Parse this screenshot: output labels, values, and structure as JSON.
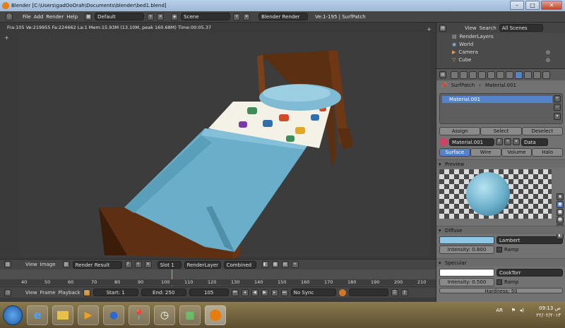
{
  "window": {
    "title": "Blender [C:\\Users\\gadOoOrah\\Documents\\blender\\bed1.blend]",
    "controls": {
      "minimize": "–",
      "maximize": "□",
      "close": "✕"
    }
  },
  "menubar": {
    "items": [
      "File",
      "Add",
      "Render",
      "Help"
    ],
    "screen_layout": "Default",
    "scene": "Scene",
    "engine": "Blender Render",
    "stats": "Ve:1-195 | SurfPatch"
  },
  "viewport": {
    "info": "Fra:105  Ve:219955 Fa:224662 La:1 Mem:15.93M (13.10M, peak 160.68M) Time:00:05.37"
  },
  "outliner": {
    "view_label": "View",
    "search_label": "Search",
    "filter_value": "All Scenes",
    "items": [
      "RenderLayers",
      "World",
      "Camera",
      "Cube"
    ]
  },
  "properties": {
    "breadcrumb": [
      "SurfPatch",
      "Material.001"
    ],
    "slot_name": "Material.001",
    "assign_label": "Assign",
    "select_label": "Select",
    "deselect_label": "Deselect",
    "material_name": "Material.001",
    "material_users": "F",
    "data_dropdown": "Data",
    "type_tabs": [
      "Surface",
      "Wire",
      "Volume",
      "Halo"
    ],
    "preview_label": "Preview",
    "diffuse_label": "Diffuse",
    "diffuse_color": "#8ec7e6",
    "diffuse_shader": "Lambert",
    "diffuse_intensity": "Intensity: 0.800",
    "diffuse_ramp": "Ramp",
    "specular_label": "Specular",
    "specular_color": "#ffffff",
    "specular_shader": "CookTorr",
    "specular_intensity": "Intensity: 0.500",
    "specular_ramp": "Ramp",
    "hardness": "Hardness: 50"
  },
  "image_editor": {
    "view_label": "View",
    "image_label": "Image",
    "image_name": "Render Result",
    "fake_user": "F",
    "slot": "Slot 1",
    "layer": "RenderLayer",
    "pass": "Combined"
  },
  "timeline": {
    "ticks": [
      "40",
      "50",
      "60",
      "70",
      "80",
      "90",
      "100",
      "110",
      "120",
      "130",
      "140",
      "150",
      "160",
      "170",
      "180",
      "190",
      "200",
      "210"
    ],
    "view_label": "View",
    "frame_label": "Frame",
    "playback_label": "Playback",
    "start": "Start: 1",
    "end": "End: 250",
    "current": "105",
    "sync": "No Sync"
  },
  "taskbar": {
    "lang": "AR",
    "time": "09:13 ص",
    "date": "٢٢/٠٢/٢٠١٣"
  }
}
